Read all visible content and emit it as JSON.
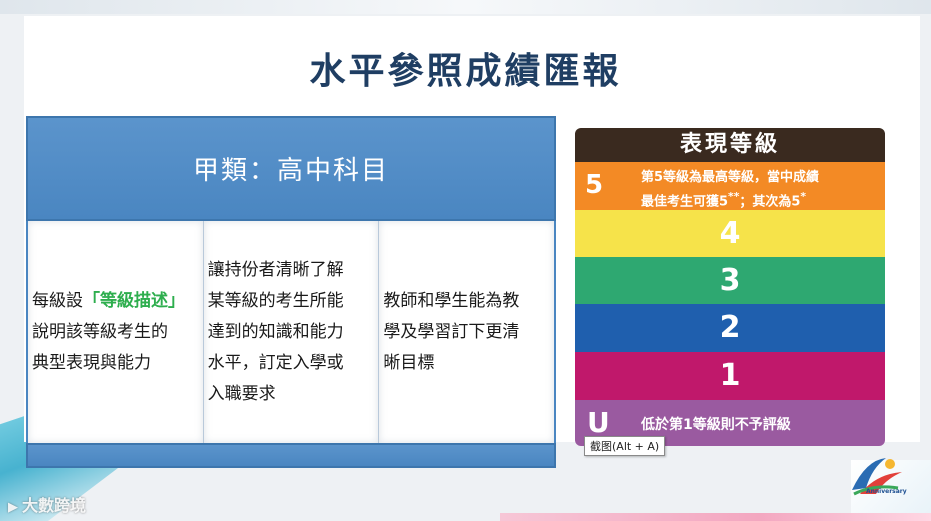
{
  "slide": {
    "title": "水平參照成績匯報"
  },
  "table": {
    "header": "甲類：高中科目",
    "columns": [
      {
        "lines": [
          {
            "parts": [
              {
                "text": "每級設",
                "highlight": false
              },
              {
                "text": "「等級描述」",
                "highlight": true
              }
            ]
          },
          {
            "parts": [
              {
                "text": "說明該等級考生的",
                "highlight": false
              }
            ]
          },
          {
            "parts": [
              {
                "text": "典型表現與能力",
                "highlight": false
              }
            ]
          }
        ]
      },
      {
        "lines": [
          {
            "parts": [
              {
                "text": "讓持份者清晰了解",
                "highlight": false
              }
            ]
          },
          {
            "parts": [
              {
                "text": "某等級的考生所能",
                "highlight": false
              }
            ]
          },
          {
            "parts": [
              {
                "text": "達到的知識和能力",
                "highlight": false
              }
            ]
          },
          {
            "parts": [
              {
                "text": "水平，訂定入學或",
                "highlight": false
              }
            ]
          },
          {
            "parts": [
              {
                "text": "入職要求",
                "highlight": false
              }
            ]
          }
        ]
      },
      {
        "lines": [
          {
            "parts": [
              {
                "text": "教師和學生能為教",
                "highlight": false
              }
            ]
          },
          {
            "parts": [
              {
                "text": "學及學習訂下更清",
                "highlight": false
              }
            ]
          },
          {
            "parts": [
              {
                "text": "晰目標",
                "highlight": false
              }
            ]
          }
        ]
      }
    ]
  },
  "levels": {
    "header": "表現等級",
    "level5": {
      "num": "5",
      "desc_line1": "第5等級為最高等級，當中成績",
      "desc_line2_a": "最佳考生可獲5",
      "desc_line2_sup1": "**",
      "desc_line2_b": "；其次為5",
      "desc_line2_sup2": "*"
    },
    "level4": "4",
    "level3": "3",
    "level2": "2",
    "level1": "1",
    "levelU": {
      "num": "U",
      "desc": "低於第1等級則不予評級"
    }
  },
  "colors": {
    "title": "#1f3e63",
    "table_header": "#4a86c1",
    "highlight": "#2eae4e",
    "level_header": "#3a2a1f",
    "level5": "#f38a25",
    "level4": "#f6e34a",
    "level3": "#2ea871",
    "level2": "#1f5fae",
    "level1": "#c0186b",
    "levelU": "#9a5aa0"
  },
  "tooltip": {
    "text": "截图(Alt + A)"
  },
  "watermark": {
    "text": "大數跨境",
    "icon": "play-logo-icon"
  },
  "logo": {
    "text": "Anniversary",
    "icon": "anniversary-logo-icon"
  }
}
